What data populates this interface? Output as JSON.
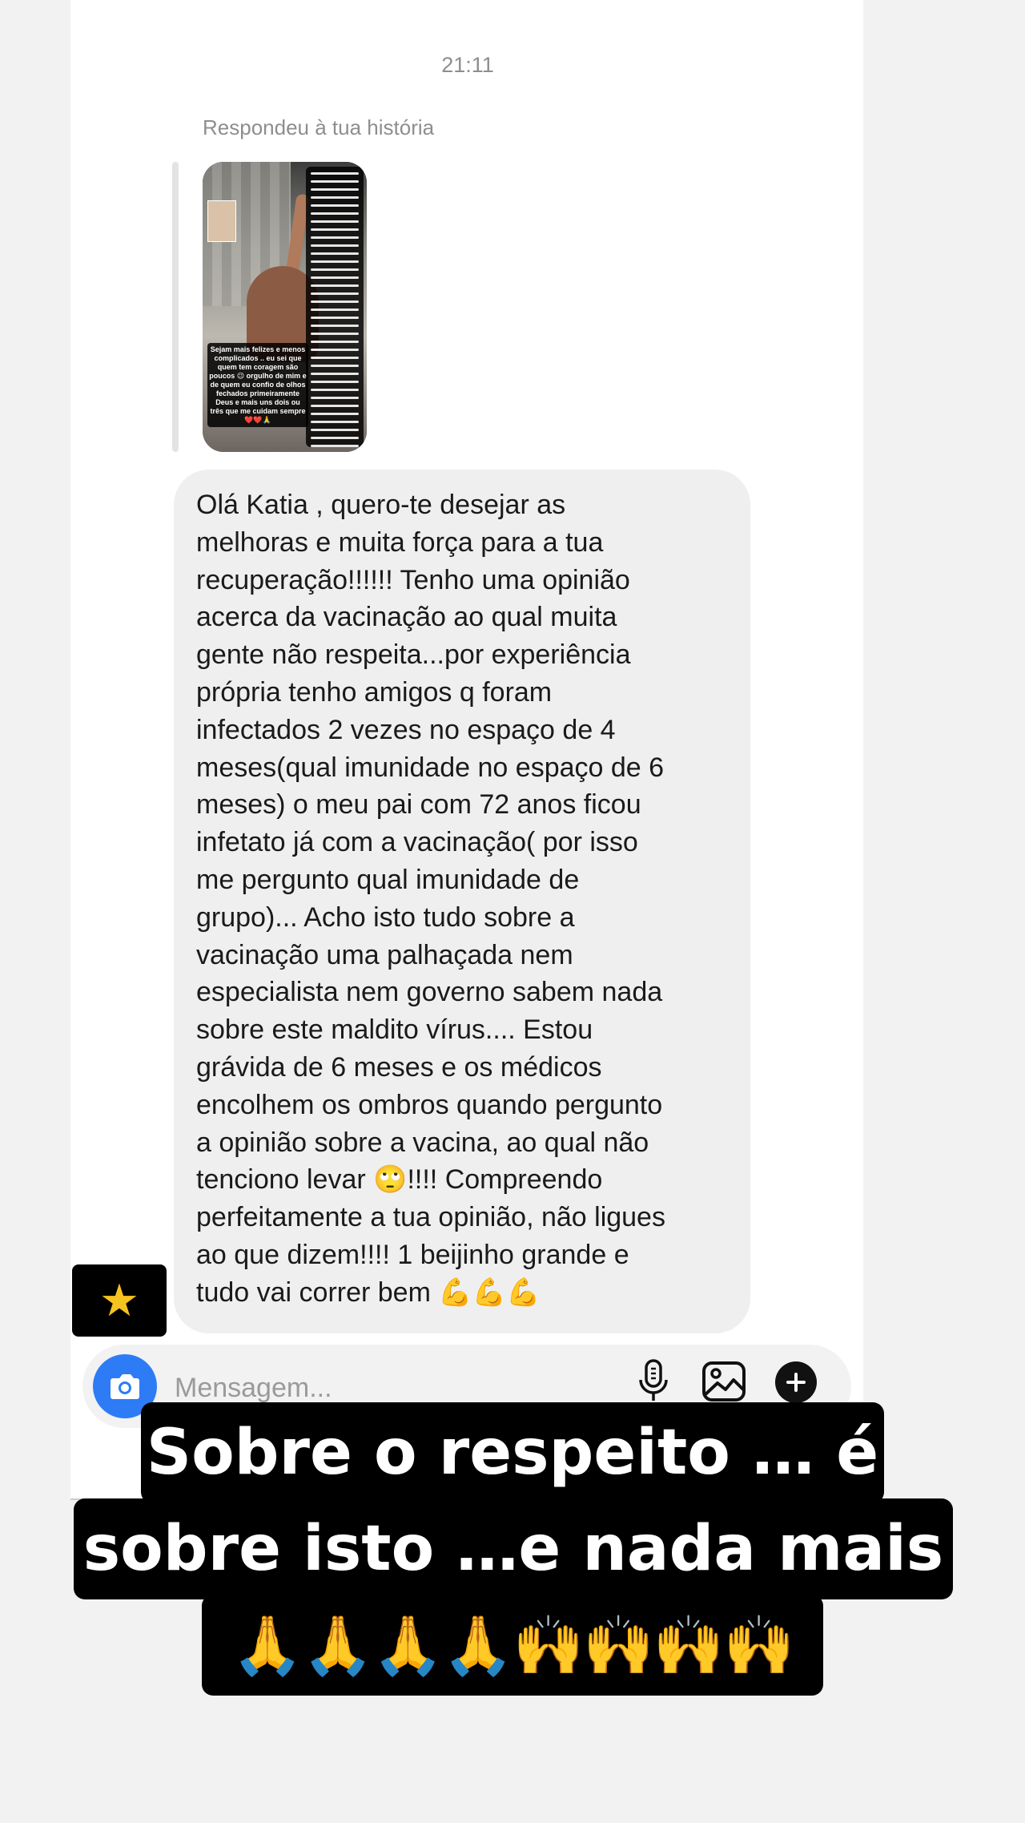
{
  "thread": {
    "timestamp": "21:11",
    "reply_label": "Respondeu à tua história"
  },
  "story_reply": {
    "caption": "Sejam mais felizes e menos complicados .. eu sei que quem tem coragem são poucos 😉 orgulho de mim e de quem eu confio de olhos fechados primeiramente Deus e mais uns dois ou três que me cuidam sempre ❤️❤️🙏"
  },
  "message": {
    "text": "Olá Katia , quero-te desejar as\nmelhoras e muita força para a tua\nrecuperação!!!!!!  Tenho uma opinião\nacerca da vacinação ao qual muita\ngente não respeita...por experiência\nprópria tenho amigos q foram\ninfectados 2 vezes no espaço de 4\nmeses(qual imunidade no espaço de 6\nmeses) o meu pai com 72 anos ficou\ninfetato já com a vacinação( por isso\nme pergunto qual imunidade de\ngrupo)... Acho isto tudo sobre a\nvacinação uma palhaçada nem\nespecialista nem governo sabem nada\nsobre este maldito vírus.... Estou\ngrávida de 6 meses e os médicos\nencolhem os ombros quando pergunto\na opinião sobre a vacina, ao qual não\ntenciono levar 🙄!!!! Compreendo\nperfeitamente a tua opinião, não ligues\nao que dizem!!!! 1 beijinho grande e\ntudo vai correr bem 💪💪💪"
  },
  "sticker": {
    "symbol": "★",
    "icon": "star-icon"
  },
  "composer": {
    "placeholder": "Mensagem...",
    "accent": "#2e7bf6",
    "icons": [
      "camera-icon",
      "microphone-icon",
      "gallery-icon",
      "plus-icon"
    ]
  },
  "story_caption": {
    "line1": "Sobre o respeito … é",
    "line2": "sobre isto …e nada mais",
    "line3": "🙏🙏🙏🙏🙌🙌🙌🙌"
  }
}
